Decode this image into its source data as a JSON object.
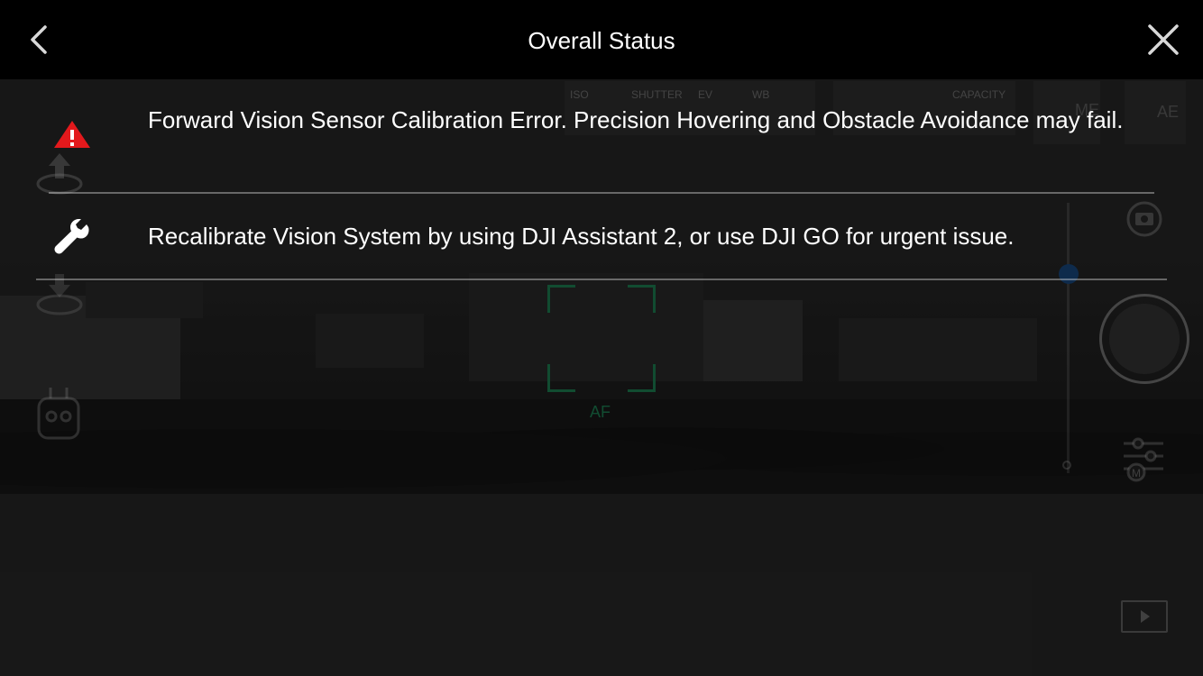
{
  "header": {
    "title": "Overall Status"
  },
  "status": {
    "error_message": "Forward Vision Sensor Calibration Error. Precision Hovering and Obstacle Avoidance may fail.",
    "fix_message": "Recalibrate Vision System by using DJI Assistant 2, or use DJI GO for urgent issue."
  },
  "camera_hud": {
    "iso_label": "ISO",
    "shutter_label": "SHUTTER",
    "ev_label": "EV",
    "wb_label": "WB",
    "capacity_label": "CAPACITY",
    "mode_label": "ME",
    "ae_label": "AE",
    "af_label": "AF"
  },
  "colors": {
    "warning": "#e3191c",
    "af_green": "#1f8a5a",
    "zoom_blue": "#1a4f8a"
  },
  "icons": {
    "warning": "warning-triangle-icon",
    "fix": "wrench-icon",
    "back": "chevron-left-icon",
    "close": "close-icon"
  }
}
